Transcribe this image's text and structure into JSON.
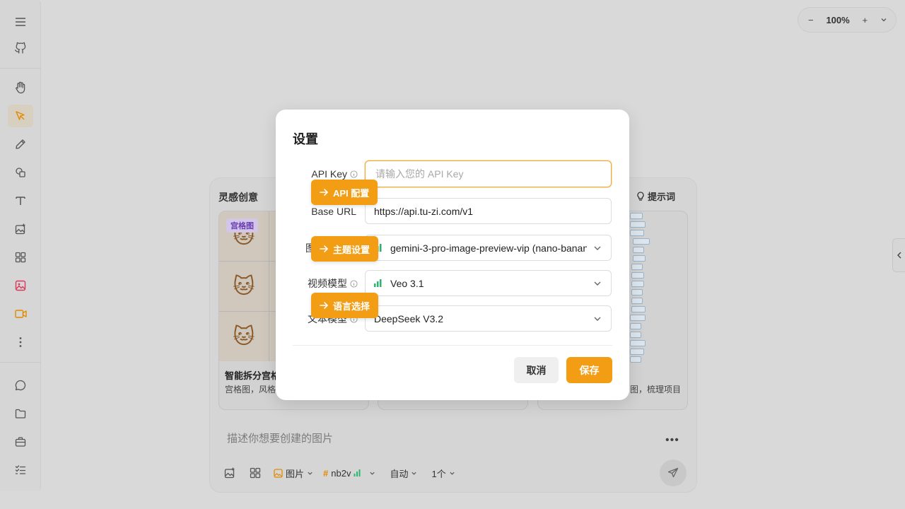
{
  "zoom": {
    "level": "100%",
    "minus": "−",
    "plus": "+"
  },
  "card": {
    "title": "灵感创意",
    "tips_label": "提示词",
    "tiles": [
      {
        "badge": "宫格图",
        "name": "智能拆分宫格",
        "desc": "宫格图，风格统"
      },
      {
        "name": "",
        "desc": ""
      },
      {
        "name": "",
        "desc": "图，梳理项目"
      }
    ],
    "prompt_placeholder": "描述你想要创建的图片",
    "more": "•••",
    "chips": {
      "type": "图片",
      "model": "nb2v",
      "ratio": "自动",
      "count": "1个"
    }
  },
  "dialog": {
    "title": "设置",
    "api_key": {
      "label": "API Key",
      "placeholder": "请输入您的 API Key",
      "value": ""
    },
    "base_url": {
      "label": "Base URL",
      "value": "https://api.tu-zi.com/v1"
    },
    "image_model": {
      "label": "图",
      "value": "gemini-3-pro-image-preview-vip (nano-banana-pro)"
    },
    "video_model": {
      "label": "视频模型",
      "value": "Veo 3.1"
    },
    "text_model": {
      "label": "文本模型",
      "value": "DeepSeek V3.2"
    },
    "cancel": "取消",
    "save": "保存"
  },
  "hints": {
    "api": "API 配置",
    "theme": "主题设置",
    "language": "语言选择"
  },
  "colors": {
    "accent": "#f29d14",
    "badge": "#6a3fb0"
  }
}
